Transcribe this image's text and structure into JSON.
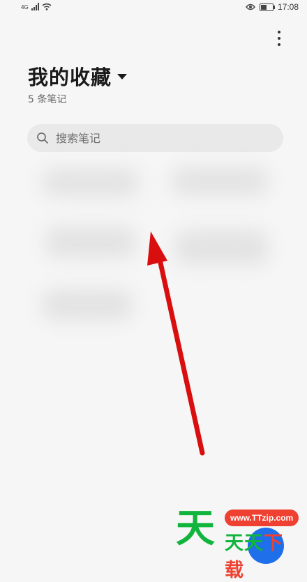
{
  "status_bar": {
    "network": "4G",
    "time": "17:08",
    "icons": [
      "signal-icon",
      "wifi-icon",
      "eye-icon",
      "battery-icon"
    ]
  },
  "header": {
    "title": "我的收藏",
    "note_count": "5 条笔记"
  },
  "search": {
    "placeholder": "搜索笔记"
  },
  "menu": {
    "icon": "more-vertical-icon"
  },
  "notes_grid": {
    "item_count": 5,
    "state": "blurred"
  },
  "fab": {
    "icon": "add-icon",
    "color": "#1e6fe9"
  },
  "annotation": {
    "icon": "red-arrow",
    "color": "#d90f0f"
  },
  "watermark": {
    "brand_char": "天",
    "url": "www.TTzip.com",
    "text_part1": "天天",
    "text_part2": "下载"
  },
  "colors": {
    "background": "#f6f6f6",
    "search_bg": "#e9e9e9"
  }
}
